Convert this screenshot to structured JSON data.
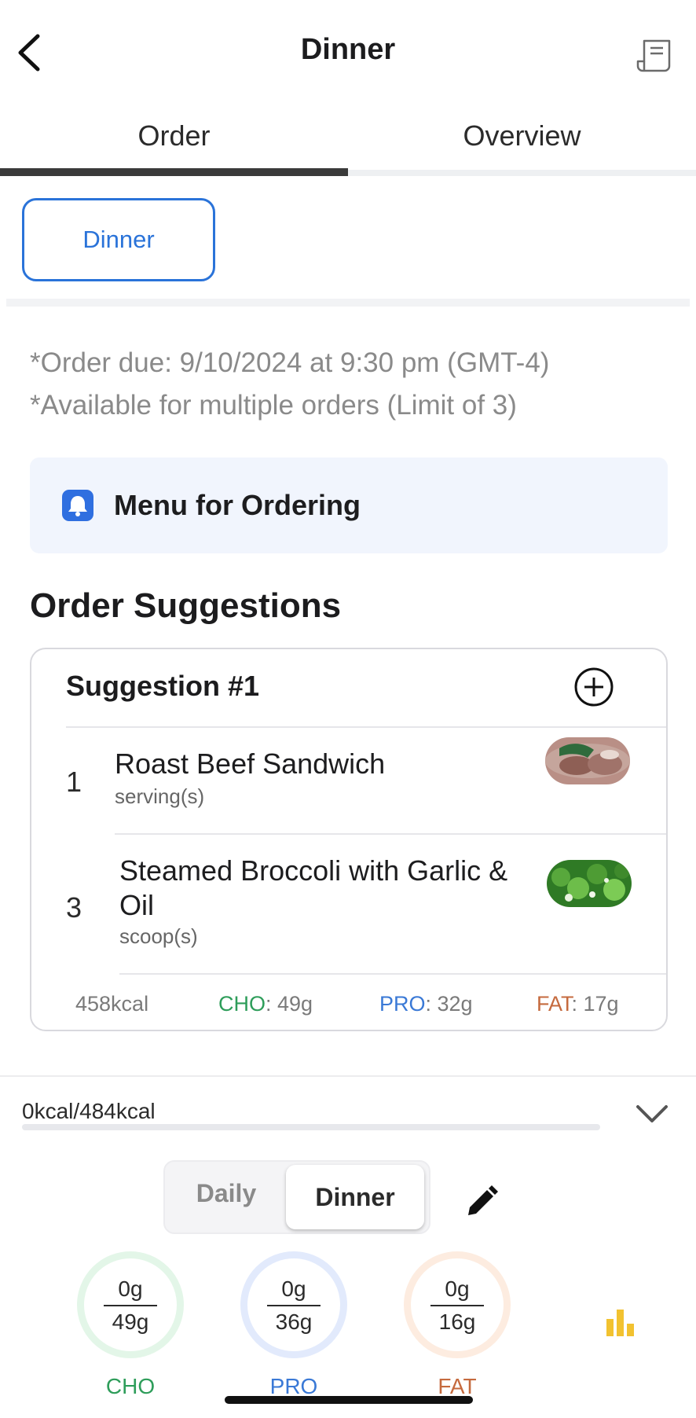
{
  "header": {
    "title": "Dinner",
    "back_icon": "chevron-left-icon",
    "receipt_icon": "receipt-icon"
  },
  "tabs": [
    {
      "label": "Order",
      "active": true
    },
    {
      "label": "Overview",
      "active": false
    }
  ],
  "meal_chip": {
    "label": "Dinner"
  },
  "info": {
    "order_due": "*Order due: 9/10/2024 at 9:30 pm (GMT-4)",
    "multiple": "*Available for multiple orders (Limit of 3)"
  },
  "banner": {
    "icon": "bell-icon",
    "text": "Menu for Ordering"
  },
  "suggestions": {
    "title": "Order Suggestions",
    "card": {
      "title": "Suggestion #1",
      "items": [
        {
          "qty": "1",
          "name": "Roast Beef Sandwich",
          "unit": "serving(s)"
        },
        {
          "qty": "3",
          "name": "Steamed Broccoli with Garlic & Oil",
          "unit": "scoop(s)"
        }
      ],
      "totals": {
        "kcal": "458kcal",
        "cho_label": "CHO",
        "cho_value": ": 49g",
        "pro_label": "PRO",
        "pro_value": ": 32g",
        "fat_label": "FAT",
        "fat_value": ": 17g"
      }
    }
  },
  "nutrition": {
    "kcal_text": "0kcal/484kcal",
    "kcal_progress": 0,
    "segment": {
      "daily": "Daily",
      "dinner": "Dinner",
      "selected": "Dinner"
    },
    "rings": [
      {
        "current": "0g",
        "target": "49g",
        "label": "CHO",
        "color": "#2e9d5a",
        "ring_color": "#e3f6e8",
        "progress": 0
      },
      {
        "current": "0g",
        "target": "36g",
        "label": "PRO",
        "color": "#3a79d6",
        "ring_color": "#e2eafc",
        "progress": 0
      },
      {
        "current": "0g",
        "target": "16g",
        "label": "FAT",
        "color": "#c56a3e",
        "ring_color": "#fdece0",
        "progress": 0
      }
    ]
  },
  "colors": {
    "accent": "#2a73d9",
    "cho": "#2e9d5a",
    "pro": "#3a79d6",
    "fat": "#c56a3e",
    "chart_icon": "#f2c230"
  }
}
